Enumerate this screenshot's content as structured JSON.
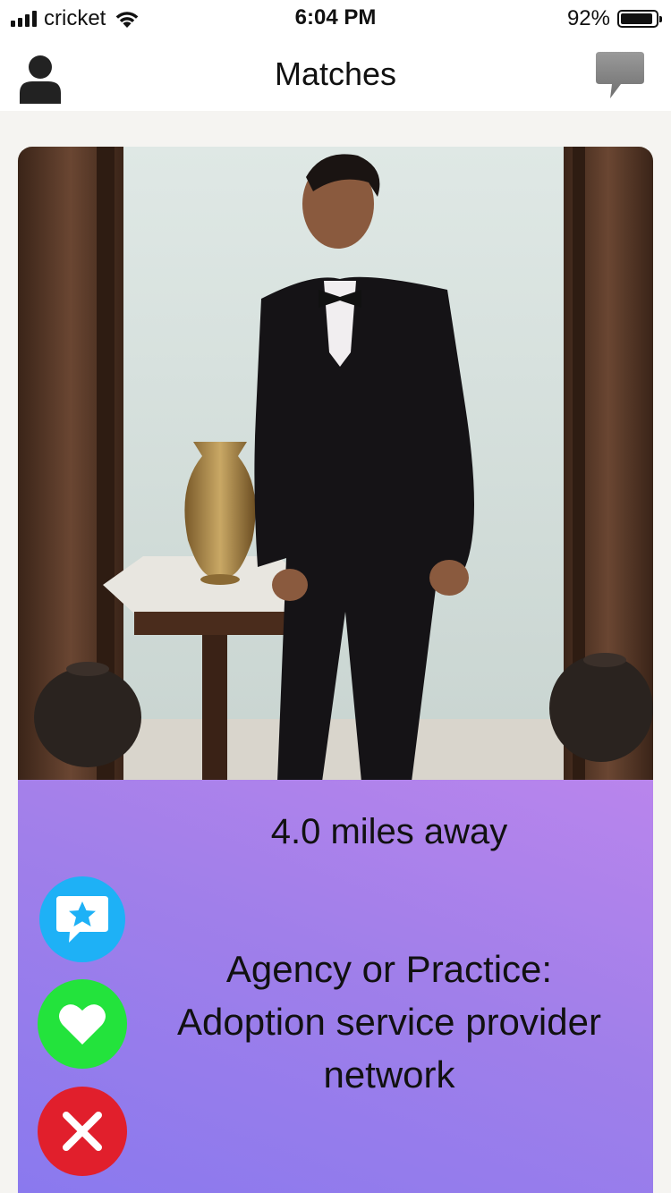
{
  "status_bar": {
    "carrier": "cricket",
    "time": "6:04 PM",
    "battery_percent": "92%",
    "battery_level": 0.92,
    "signal_bars": 4,
    "icons": [
      "signal-icon",
      "wifi-icon",
      "battery-icon"
    ]
  },
  "nav": {
    "title": "Matches",
    "left_icon": "profile-icon",
    "right_icon": "chat-bubble-icon"
  },
  "card": {
    "photo": "profile-photo",
    "distance": "4.0 miles away",
    "agency_label": "Agency or Practice:",
    "agency_value": "Adoption service provider network",
    "actions": [
      {
        "name": "super-like",
        "icon": "star-chat-icon",
        "color": "#1eb1f6"
      },
      {
        "name": "like",
        "icon": "heart-icon",
        "color": "#23e33c"
      },
      {
        "name": "nope",
        "icon": "close-icon",
        "color": "#e11f2c"
      }
    ]
  },
  "colors": {
    "info_gradient_start": "#b985ec",
    "info_gradient_end": "#8a79ee"
  }
}
